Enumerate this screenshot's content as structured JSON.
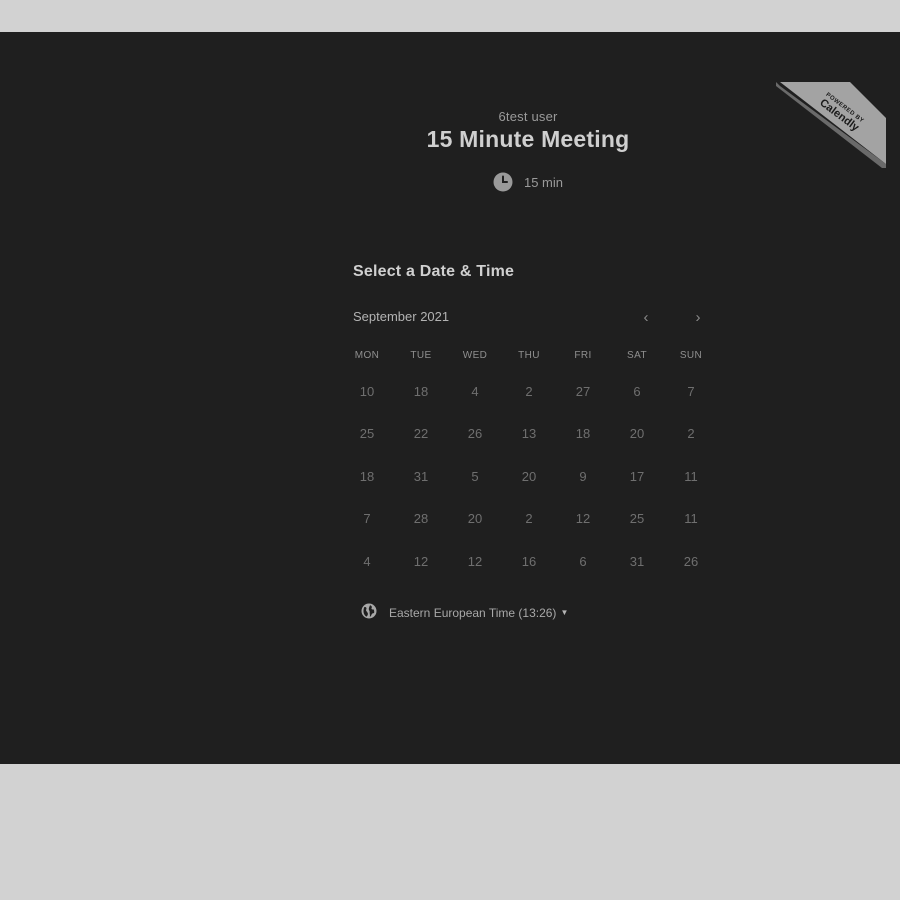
{
  "host": {
    "name": "6test user"
  },
  "event": {
    "title": "15 Minute Meeting",
    "duration": "15 min",
    "duration_icon": "clock-icon"
  },
  "scheduler": {
    "title": "Select a Date & Time",
    "month": "September 2021",
    "prev_icon": "chevron-left-icon",
    "next_icon": "chevron-right-icon",
    "prev_glyph": "‹",
    "next_glyph": "›",
    "weekdays": [
      "MON",
      "TUE",
      "WED",
      "THU",
      "FRI",
      "SAT",
      "SUN"
    ],
    "weeks": [
      [
        "10",
        "18",
        "4",
        "2",
        "27",
        "6",
        "7"
      ],
      [
        "25",
        "22",
        "26",
        "13",
        "18",
        "20",
        "2"
      ],
      [
        "18",
        "31",
        "5",
        "20",
        "9",
        "17",
        "11"
      ],
      [
        "7",
        "28",
        "20",
        "2",
        "12",
        "25",
        "11"
      ],
      [
        "4",
        "12",
        "12",
        "16",
        "6",
        "31",
        "26"
      ]
    ]
  },
  "timezone": {
    "label": "Eastern European Time (13:26)",
    "icon": "globe-icon",
    "caret": "▼"
  },
  "badge": {
    "line1": "POWERED BY",
    "line2": "Calendly"
  },
  "colors": {
    "page_background": "#d2d2d2",
    "panel_background": "#1f1f1f",
    "title_text": "#cfcfcf",
    "muted_text": "#9b9b9b",
    "day_text": "#6f6f6f",
    "badge_fill": "#a3a3a3"
  }
}
